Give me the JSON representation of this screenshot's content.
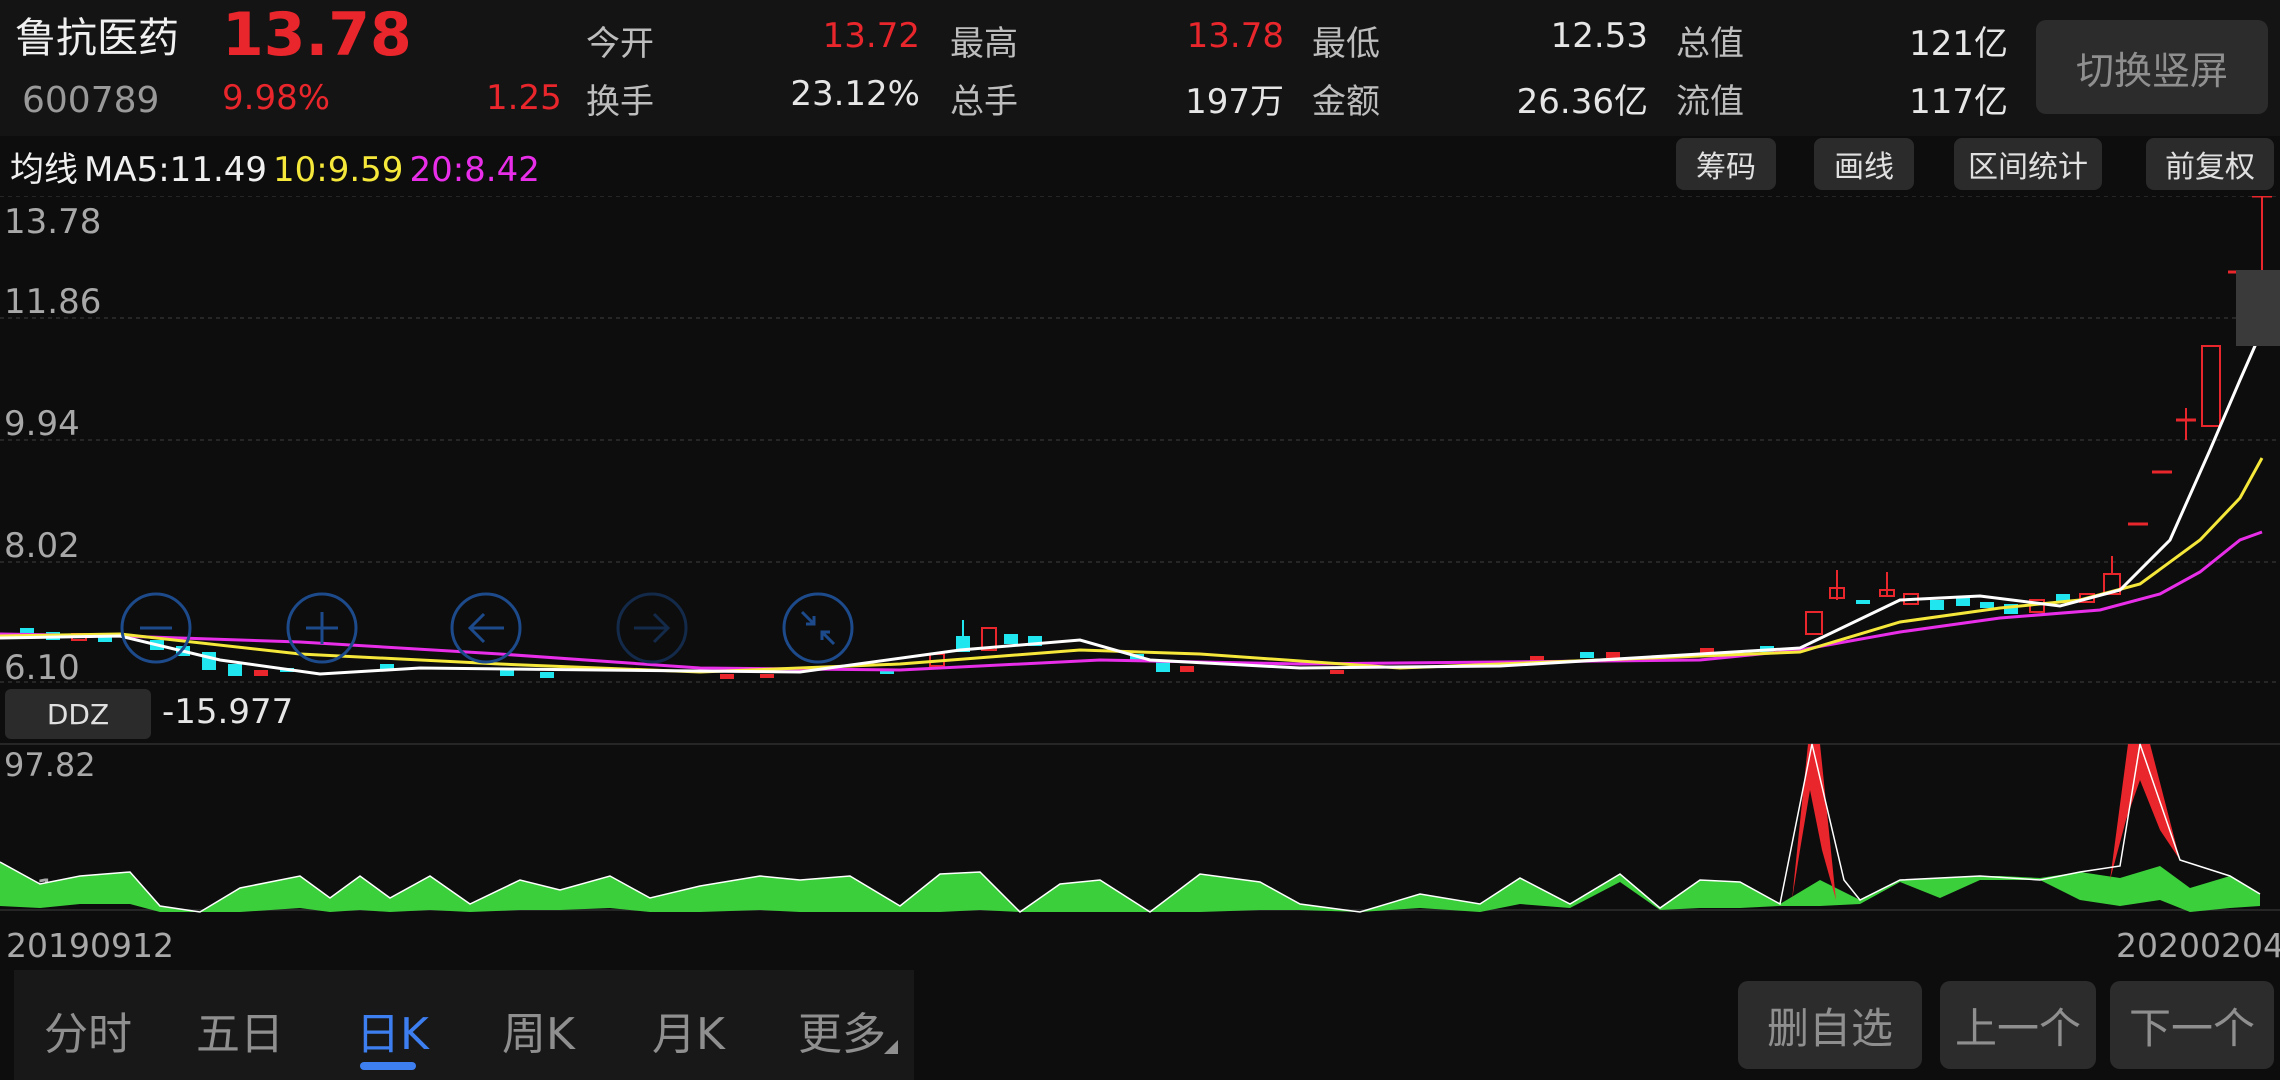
{
  "header": {
    "name": "鲁抗医药",
    "code": "600789",
    "price": "13.78",
    "change_pct": "9.98%",
    "change": "1.25",
    "stats": [
      {
        "label": "今开",
        "value": "13.72",
        "color": "red"
      },
      {
        "label": "换手",
        "value": "23.12%",
        "color": "white"
      },
      {
        "label": "最高",
        "value": "13.78",
        "color": "red"
      },
      {
        "label": "总手",
        "value": "197万",
        "color": "white"
      },
      {
        "label": "最低",
        "value": "12.53",
        "color": "white"
      },
      {
        "label": "金额",
        "value": "26.36亿",
        "color": "white"
      },
      {
        "label": "总值",
        "value": "121亿",
        "color": "white"
      },
      {
        "label": "流值",
        "value": "117亿",
        "color": "white"
      }
    ],
    "switch_label": "切换竖屏"
  },
  "ma_bar": {
    "title": "均线",
    "ma5": "MA5:11.49",
    "ma10": "10:9.59",
    "ma20": "20:8.42",
    "colors": {
      "ma5": "#ffffff",
      "ma10": "#f5e83a",
      "ma20": "#e82ee8"
    }
  },
  "tools": [
    "筹码",
    "画线",
    "区间统计",
    "前复权"
  ],
  "price_axis": [
    "13.78",
    "11.86",
    "9.94",
    "8.02",
    "6.10"
  ],
  "ddz": {
    "label": "DDZ",
    "value": "-15.977",
    "axis_top": "97.82",
    "axis_bottom": "-31.16"
  },
  "dates": {
    "start": "20190912",
    "end": "20200204"
  },
  "tabs": [
    "分时",
    "五日",
    "日K",
    "周K",
    "月K",
    "更多"
  ],
  "active_tab": "日K",
  "buttons": {
    "remove": "删自选",
    "prev": "上一个",
    "next": "下一个"
  },
  "colors": {
    "up": "#e8262b",
    "down": "#1fe6ef",
    "accent": "#3d7ff0",
    "ddz_green": "#3ccf3c"
  },
  "chart_data": {
    "type": "candlestick",
    "y_range": [
      6.1,
      13.78
    ],
    "last_candles": [
      {
        "open": 8.5,
        "close": 8.5
      },
      {
        "open": 9.0,
        "close": 9.0
      },
      {
        "open": 9.6,
        "close": 9.6
      },
      {
        "open": 10.0,
        "close": 10.0
      },
      {
        "open": 10.9,
        "close": 10.0
      },
      {
        "open": 12.53,
        "close": 12.53
      },
      {
        "open": 13.72,
        "close": 13.78
      }
    ]
  }
}
